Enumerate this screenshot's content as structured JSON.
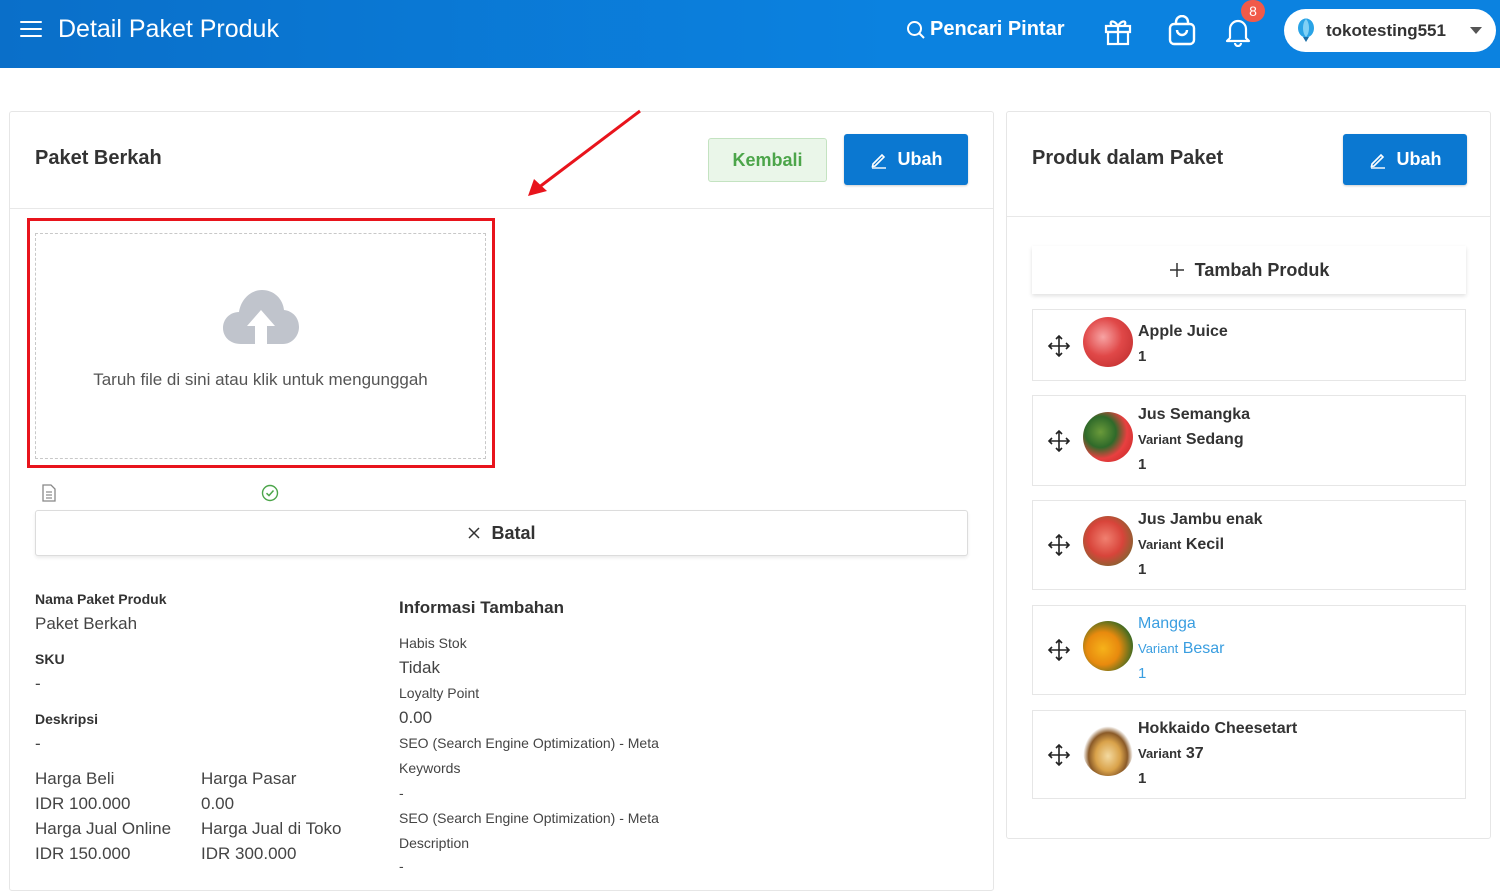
{
  "header": {
    "title": "Detail Paket Produk",
    "search_label": "Pencari Pintar",
    "notification_count": "8",
    "store_name": "tokotesting551"
  },
  "left_card": {
    "title": "Paket Berkah",
    "back_label": "Kembali",
    "edit_label": "Ubah",
    "upload_text": "Taruh file di sini atau klik untuk mengunggah",
    "cancel_label": "Batal",
    "fields": {
      "nama_label": "Nama Paket Produk",
      "nama_value": "Paket Berkah",
      "sku_label": "SKU",
      "sku_value": "-",
      "deskripsi_label": "Deskripsi",
      "deskripsi_value": "-",
      "harga_beli_label": "Harga Beli",
      "harga_beli_value": "IDR 100.000",
      "harga_pasar_label": "Harga Pasar",
      "harga_pasar_value": "0.00",
      "harga_jual_online_label": "Harga Jual Online",
      "harga_jual_online_value": "IDR 150.000",
      "harga_jual_toko_label": "Harga Jual di Toko",
      "harga_jual_toko_value": "IDR 300.000"
    },
    "info": {
      "title": "Informasi Tambahan",
      "habis_stok_label": "Habis Stok",
      "habis_stok_value": "Tidak",
      "loyalty_label": "Loyalty Point",
      "loyalty_value": "0.00",
      "seo_keywords_label_1": "SEO (Search Engine Optimization) - Meta",
      "seo_keywords_label_2": "Keywords",
      "seo_keywords_value": "-",
      "seo_desc_label_1": "SEO (Search Engine Optimization) - Meta",
      "seo_desc_label_2": "Description",
      "seo_desc_value": "-"
    }
  },
  "right_card": {
    "title": "Produk dalam Paket",
    "edit_label": "Ubah",
    "add_label": "Tambah Produk",
    "variant_word": "Variant",
    "products": [
      {
        "name": "Apple Juice",
        "variant": "",
        "qty": "1"
      },
      {
        "name": "Jus Semangka",
        "variant": "Sedang",
        "qty": "1"
      },
      {
        "name": "Jus Jambu enak",
        "variant": "Kecil",
        "qty": "1"
      },
      {
        "name": "Mangga",
        "variant": "Besar",
        "qty": "1"
      },
      {
        "name": "Hokkaido Cheesetart",
        "variant": "37",
        "qty": "1"
      }
    ]
  },
  "colors": {
    "primary": "#0b78d1",
    "accent_red": "#e8141c",
    "success_green": "#4ca54a",
    "link_blue": "#3a9ee0"
  }
}
